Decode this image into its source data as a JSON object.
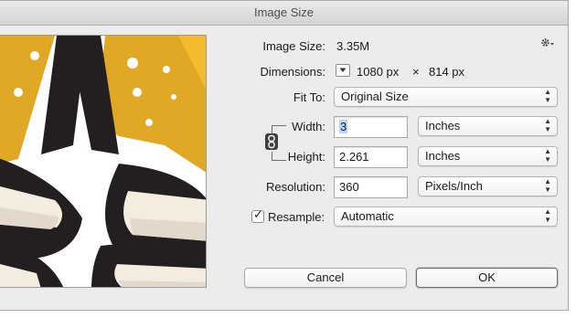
{
  "window": {
    "title": "Image Size"
  },
  "image_size": {
    "label": "Image Size:",
    "value": "3.35M"
  },
  "dimensions": {
    "label": "Dimensions:",
    "width": "1080 px",
    "times": "×",
    "height": "814 px"
  },
  "fit_to": {
    "label": "Fit To:",
    "value": "Original Size"
  },
  "width": {
    "label": "Width:",
    "value": "3",
    "unit": "Inches"
  },
  "height": {
    "label": "Height:",
    "value": "2.261",
    "unit": "Inches"
  },
  "resolution": {
    "label": "Resolution:",
    "value": "360",
    "unit": "Pixels/Inch"
  },
  "resample": {
    "label": "Resample:",
    "value": "Automatic",
    "checked": true,
    "check_glyph": "✓"
  },
  "buttons": {
    "cancel": "Cancel",
    "ok": "OK"
  },
  "icons": {
    "settings": "gear-icon",
    "dimensions_menu": "triangle-down-icon",
    "link": "chain-link-icon",
    "popup_arrows": "up-down-arrows-icon"
  },
  "colors": {
    "dialog_bg": "#ececec",
    "preview_yellow": "#e1a826",
    "preview_dark": "#231f20",
    "preview_cream": "#f3ecdf",
    "selection": "#b4d5fe"
  }
}
